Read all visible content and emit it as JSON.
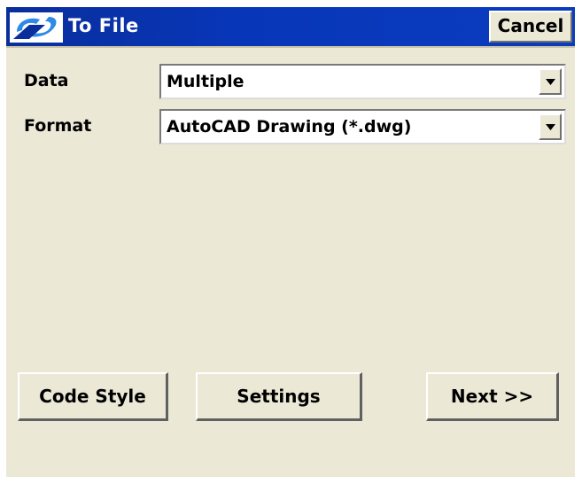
{
  "titlebar": {
    "title": "To File",
    "icon": "app-logo-icon",
    "cancel_label": "Cancel",
    "color": "#0836b8"
  },
  "form": {
    "data_label": "Data",
    "data_value": "Multiple",
    "format_label": "Format",
    "format_value": "AutoCAD Drawing (*.dwg)"
  },
  "buttons": {
    "code_style": "Code Style",
    "settings": "Settings",
    "next": "Next >>"
  },
  "colors": {
    "window_background": "#ebe8d6",
    "titlebar": "#0836b8",
    "logo": "#2e8ae6"
  }
}
